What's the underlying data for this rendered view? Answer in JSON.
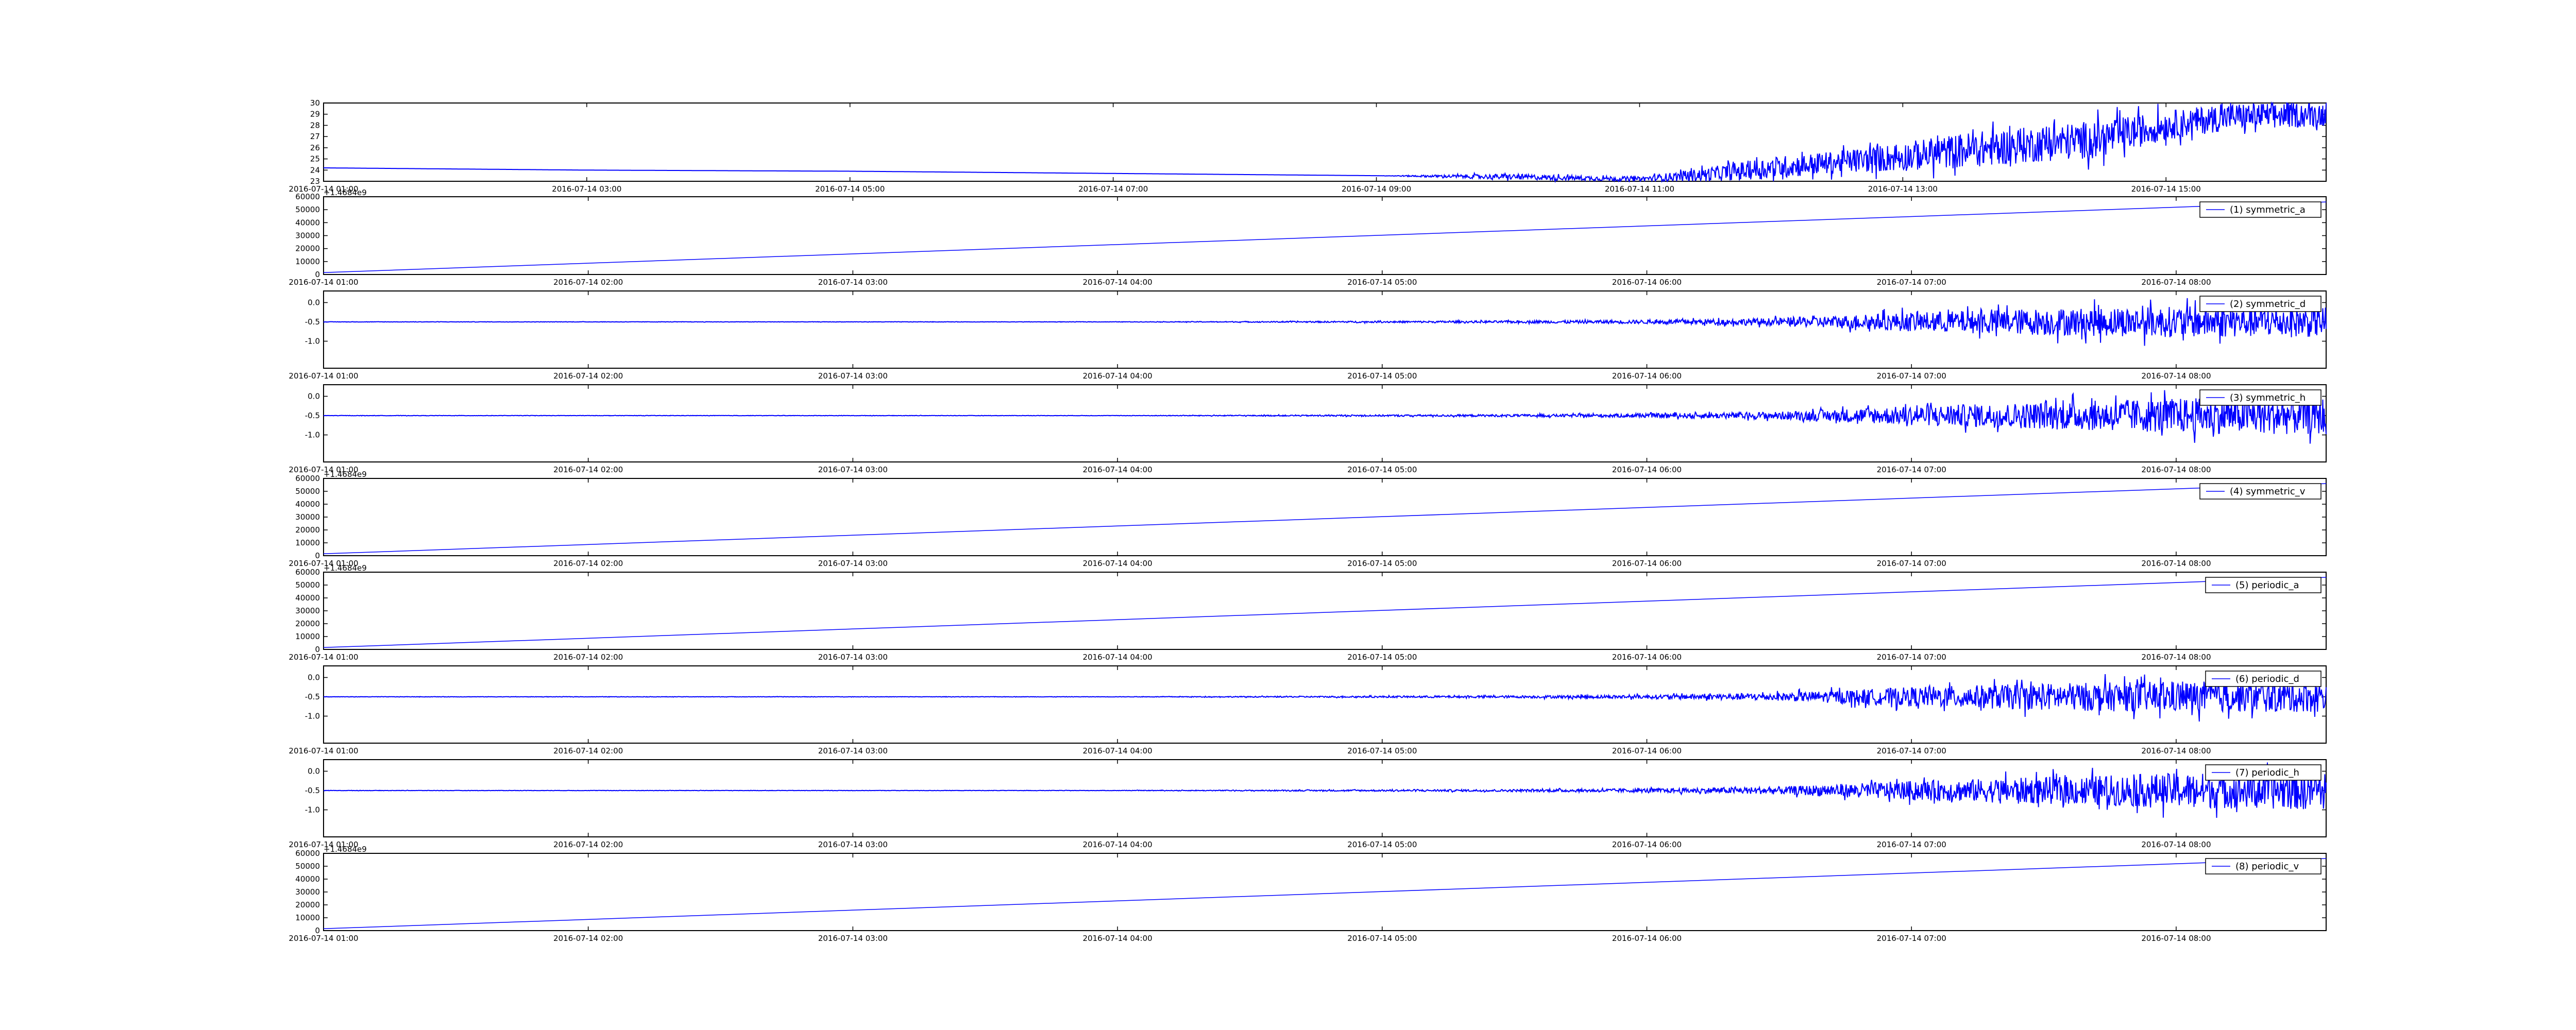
{
  "figure": {
    "background": "#ffffff",
    "line_color": "#0000ff"
  },
  "chart_data": [
    {
      "type": "line",
      "title": "",
      "xlabel": "",
      "ylabel": "",
      "legend": null,
      "ylim": [
        23,
        30
      ],
      "yticks": [
        "23",
        "24",
        "25",
        "26",
        "27",
        "28",
        "29",
        "30"
      ],
      "xticks": [
        "2016-07-14 01:00",
        "2016-07-14 03:00",
        "2016-07-14 05:00",
        "2016-07-14 07:00",
        "2016-07-14 09:00",
        "2016-07-14 11:00",
        "2016-07-14 13:00",
        "2016-07-14 15:00"
      ],
      "xrange": [
        "2016-07-14 01:00",
        "2016-07-14 16:13"
      ],
      "series": [
        {
          "x": [
            "2016-07-14 01:00",
            "2016-07-14 03:00",
            "2016-07-14 05:00",
            "2016-07-14 07:00",
            "2016-07-14 09:00",
            "2016-07-14 10:00",
            "2016-07-14 11:00",
            "2016-07-14 11:30",
            "2016-07-14 12:00",
            "2016-07-14 12:30",
            "2016-07-14 13:00",
            "2016-07-14 13:30",
            "2016-07-14 14:00",
            "2016-07-14 14:30",
            "2016-07-14 15:00",
            "2016-07-14 15:30",
            "2016-07-14 16:13"
          ],
          "values": [
            24.2,
            24.0,
            23.9,
            23.7,
            23.5,
            23.4,
            23.2,
            23.6,
            24.2,
            24.7,
            25.2,
            25.8,
            26.3,
            26.8,
            28.0,
            28.8,
            29.0
          ],
          "spread": [
            0,
            0,
            0,
            0,
            0,
            0.25,
            0.2,
            0.6,
            1.0,
            1.0,
            1.3,
            1.6,
            1.6,
            1.7,
            1.3,
            1.2,
            1.1
          ]
        }
      ]
    },
    {
      "type": "line",
      "legend": "(1) symmetric_a",
      "offset_label": "+1.4684e9",
      "ylim": [
        0,
        60000
      ],
      "yticks": [
        "0",
        "10000",
        "20000",
        "30000",
        "40000",
        "50000",
        "60000"
      ],
      "xticks": [
        "2016-07-14 01:00",
        "2016-07-14 02:00",
        "2016-07-14 03:00",
        "2016-07-14 04:00",
        "2016-07-14 05:00",
        "2016-07-14 06:00",
        "2016-07-14 07:00",
        "2016-07-14 08:00"
      ],
      "xrange": [
        "2016-07-14 01:00",
        "2016-07-14 08:34"
      ],
      "series": [
        {
          "x": [
            "2016-07-14 01:00",
            "2016-07-14 08:34"
          ],
          "values": [
            1500,
            56000
          ]
        }
      ]
    },
    {
      "type": "line",
      "legend": "(2) symmetric_d",
      "ylim": [
        -1.7,
        0.3
      ],
      "yticks": [
        "-1.0",
        "-0.5",
        "0.0"
      ],
      "xticks": [
        "2016-07-14 01:00",
        "2016-07-14 02:00",
        "2016-07-14 03:00",
        "2016-07-14 04:00",
        "2016-07-14 05:00",
        "2016-07-14 06:00",
        "2016-07-14 07:00",
        "2016-07-14 08:00"
      ],
      "xrange": [
        "2016-07-14 01:00",
        "2016-07-14 08:34"
      ],
      "series": [
        {
          "x": [
            "2016-07-14 01:00",
            "2016-07-14 04:00",
            "2016-07-14 05:30",
            "2016-07-14 06:00",
            "2016-07-14 06:30",
            "2016-07-14 07:00",
            "2016-07-14 07:30",
            "2016-07-14 08:00",
            "2016-07-14 08:34"
          ],
          "values": [
            -0.5,
            -0.5,
            -0.5,
            -0.5,
            -0.5,
            -0.5,
            -0.5,
            -0.5,
            -0.5
          ],
          "spread": [
            0.005,
            0.005,
            0.03,
            0.05,
            0.1,
            0.25,
            0.35,
            0.4,
            0.4
          ]
        }
      ]
    },
    {
      "type": "line",
      "legend": "(3) symmetric_h",
      "ylim": [
        -1.7,
        0.3
      ],
      "yticks": [
        "-1.0",
        "-0.5",
        "0.0"
      ],
      "xticks": [
        "2016-07-14 01:00",
        "2016-07-14 02:00",
        "2016-07-14 03:00",
        "2016-07-14 04:00",
        "2016-07-14 05:00",
        "2016-07-14 06:00",
        "2016-07-14 07:00",
        "2016-07-14 08:00"
      ],
      "xrange": [
        "2016-07-14 01:00",
        "2016-07-14 08:34"
      ],
      "series": [
        {
          "x": [
            "2016-07-14 01:00",
            "2016-07-14 04:00",
            "2016-07-14 05:30",
            "2016-07-14 06:00",
            "2016-07-14 06:30",
            "2016-07-14 07:00",
            "2016-07-14 07:30",
            "2016-07-14 08:00",
            "2016-07-14 08:34"
          ],
          "values": [
            -0.5,
            -0.5,
            -0.5,
            -0.5,
            -0.5,
            -0.5,
            -0.5,
            -0.5,
            -0.5
          ],
          "spread": [
            0.005,
            0.005,
            0.03,
            0.05,
            0.1,
            0.25,
            0.35,
            0.45,
            0.5
          ]
        }
      ]
    },
    {
      "type": "line",
      "legend": "(4) symmetric_v",
      "offset_label": "+1.4684e9",
      "ylim": [
        0,
        60000
      ],
      "yticks": [
        "0",
        "10000",
        "20000",
        "30000",
        "40000",
        "50000",
        "60000"
      ],
      "xticks": [
        "2016-07-14 01:00",
        "2016-07-14 02:00",
        "2016-07-14 03:00",
        "2016-07-14 04:00",
        "2016-07-14 05:00",
        "2016-07-14 06:00",
        "2016-07-14 07:00",
        "2016-07-14 08:00"
      ],
      "xrange": [
        "2016-07-14 01:00",
        "2016-07-14 08:34"
      ],
      "series": [
        {
          "x": [
            "2016-07-14 01:00",
            "2016-07-14 08:34"
          ],
          "values": [
            1500,
            56000
          ]
        }
      ]
    },
    {
      "type": "line",
      "legend": "(5) periodic_a",
      "offset_label": "+1.4684e9",
      "ylim": [
        0,
        60000
      ],
      "yticks": [
        "0",
        "10000",
        "20000",
        "30000",
        "40000",
        "50000",
        "60000"
      ],
      "xticks": [
        "2016-07-14 01:00",
        "2016-07-14 02:00",
        "2016-07-14 03:00",
        "2016-07-14 04:00",
        "2016-07-14 05:00",
        "2016-07-14 06:00",
        "2016-07-14 07:00",
        "2016-07-14 08:00"
      ],
      "xrange": [
        "2016-07-14 01:00",
        "2016-07-14 08:34"
      ],
      "series": [
        {
          "x": [
            "2016-07-14 01:00",
            "2016-07-14 08:34"
          ],
          "values": [
            1500,
            56000
          ]
        }
      ]
    },
    {
      "type": "line",
      "legend": "(6) periodic_d",
      "ylim": [
        -1.7,
        0.3
      ],
      "yticks": [
        "-1.0",
        "-0.5",
        "0.0"
      ],
      "xticks": [
        "2016-07-14 01:00",
        "2016-07-14 02:00",
        "2016-07-14 03:00",
        "2016-07-14 04:00",
        "2016-07-14 05:00",
        "2016-07-14 06:00",
        "2016-07-14 07:00",
        "2016-07-14 08:00"
      ],
      "xrange": [
        "2016-07-14 01:00",
        "2016-07-14 08:34"
      ],
      "series": [
        {
          "x": [
            "2016-07-14 01:00",
            "2016-07-14 04:00",
            "2016-07-14 05:30",
            "2016-07-14 06:00",
            "2016-07-14 06:30",
            "2016-07-14 07:00",
            "2016-07-14 07:30",
            "2016-07-14 08:00",
            "2016-07-14 08:34"
          ],
          "values": [
            -0.5,
            -0.5,
            -0.5,
            -0.5,
            -0.5,
            -0.5,
            -0.5,
            -0.5,
            -0.5
          ],
          "spread": [
            0.005,
            0.005,
            0.03,
            0.05,
            0.1,
            0.25,
            0.35,
            0.4,
            0.4
          ]
        }
      ]
    },
    {
      "type": "line",
      "legend": "(7) periodic_h",
      "ylim": [
        -1.7,
        0.3
      ],
      "yticks": [
        "-1.0",
        "-0.5",
        "0.0"
      ],
      "xticks": [
        "2016-07-14 01:00",
        "2016-07-14 02:00",
        "2016-07-14 03:00",
        "2016-07-14 04:00",
        "2016-07-14 05:00",
        "2016-07-14 06:00",
        "2016-07-14 07:00",
        "2016-07-14 08:00"
      ],
      "xrange": [
        "2016-07-14 01:00",
        "2016-07-14 08:34"
      ],
      "series": [
        {
          "x": [
            "2016-07-14 01:00",
            "2016-07-14 04:00",
            "2016-07-14 05:30",
            "2016-07-14 06:00",
            "2016-07-14 06:30",
            "2016-07-14 07:00",
            "2016-07-14 07:30",
            "2016-07-14 08:00",
            "2016-07-14 08:34"
          ],
          "values": [
            -0.5,
            -0.5,
            -0.5,
            -0.5,
            -0.5,
            -0.5,
            -0.5,
            -0.5,
            -0.5
          ],
          "spread": [
            0.005,
            0.005,
            0.03,
            0.05,
            0.1,
            0.25,
            0.35,
            0.45,
            0.5
          ]
        }
      ]
    },
    {
      "type": "line",
      "legend": "(8) periodic_v",
      "offset_label": "+1.4684e9",
      "ylim": [
        0,
        60000
      ],
      "yticks": [
        "0",
        "10000",
        "20000",
        "30000",
        "40000",
        "50000",
        "60000"
      ],
      "xticks": [
        "2016-07-14 01:00",
        "2016-07-14 02:00",
        "2016-07-14 03:00",
        "2016-07-14 04:00",
        "2016-07-14 05:00",
        "2016-07-14 06:00",
        "2016-07-14 07:00",
        "2016-07-14 08:00"
      ],
      "xrange": [
        "2016-07-14 01:00",
        "2016-07-14 08:34"
      ],
      "series": [
        {
          "x": [
            "2016-07-14 01:00",
            "2016-07-14 08:34"
          ],
          "values": [
            1500,
            56000
          ]
        }
      ]
    }
  ]
}
